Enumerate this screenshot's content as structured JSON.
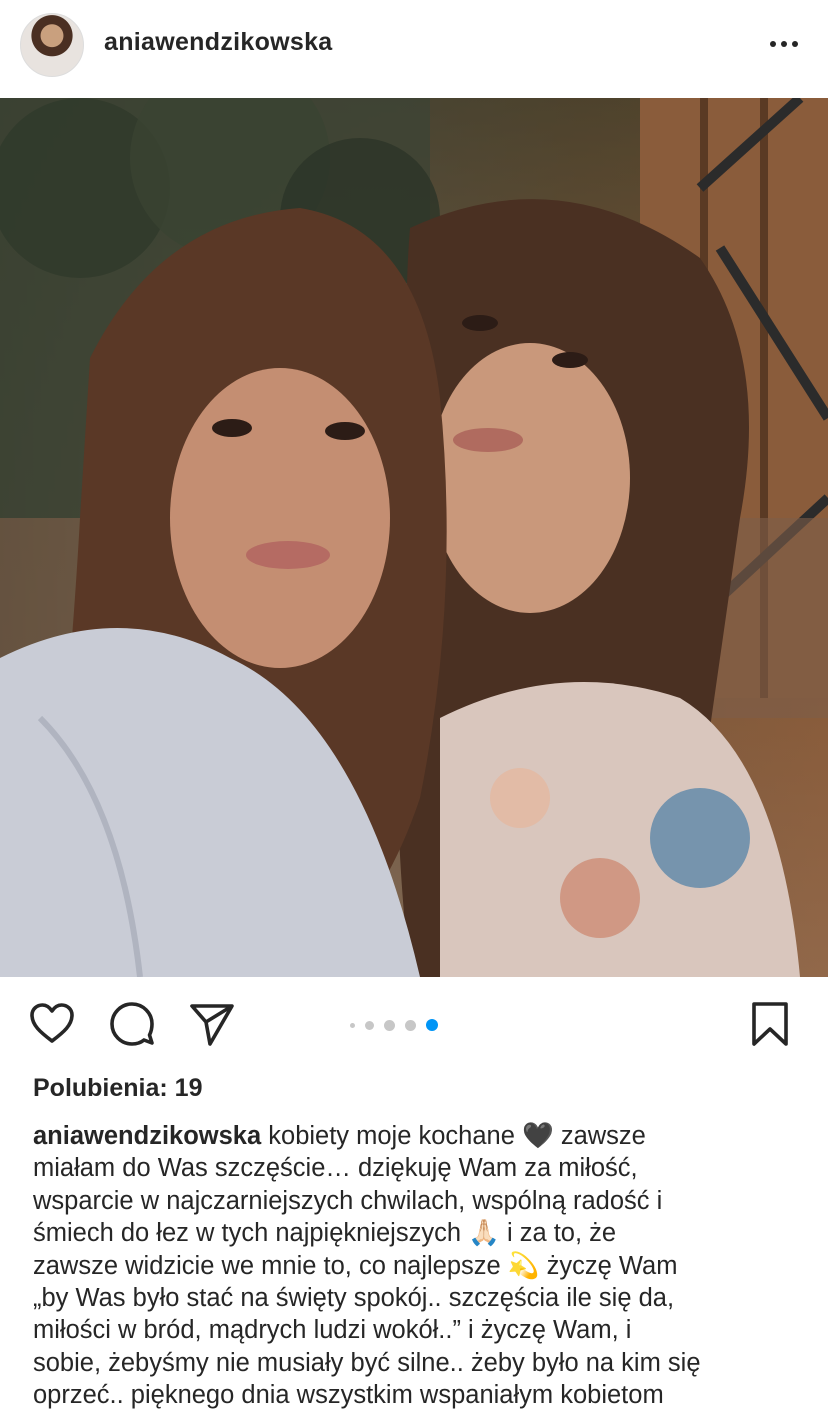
{
  "post": {
    "username": "aniawendzikowska",
    "more_icon": "more-horizontal-icon",
    "avatar": "profile-avatar"
  },
  "photo": {
    "carousel_total": 5,
    "carousel_active": 5
  },
  "actions": {
    "like_icon": "heart-icon",
    "comment_icon": "comment-icon",
    "share_icon": "send-icon",
    "save_icon": "bookmark-icon"
  },
  "likes": {
    "label": "Polubienia: 19"
  },
  "caption": {
    "username": "aniawendzikowska",
    "line1": " kobiety moje kochane 🖤 zawsze",
    "line2": "miałam do Was szczęście… dziękuję Wam za miłość,",
    "line3": "wsparcie w najczarniejszych chwilach, wspólną radość i",
    "line4": "śmiech do łez w tych najpiękniejszych 🙏🏻 i za to, że",
    "line5": "zawsze widzicie we mnie to, co najlepsze 💫 życzę Wam",
    "line6": "„by Was było stać na święty spokój.. szczęścia ile się da,",
    "line7": "miłości w bród, mądrych ludzi wokół..” i życzę Wam, i",
    "line8": "sobie, żebyśmy nie musiały być silne.. żeby było na kim się",
    "line9": "oprzeć.. pięknego dnia wszystkim wspaniałym kobietom"
  },
  "colors": {
    "text": "#262626",
    "carousel_active": "#0095f6",
    "carousel_inactive": "#c7c7c7"
  }
}
